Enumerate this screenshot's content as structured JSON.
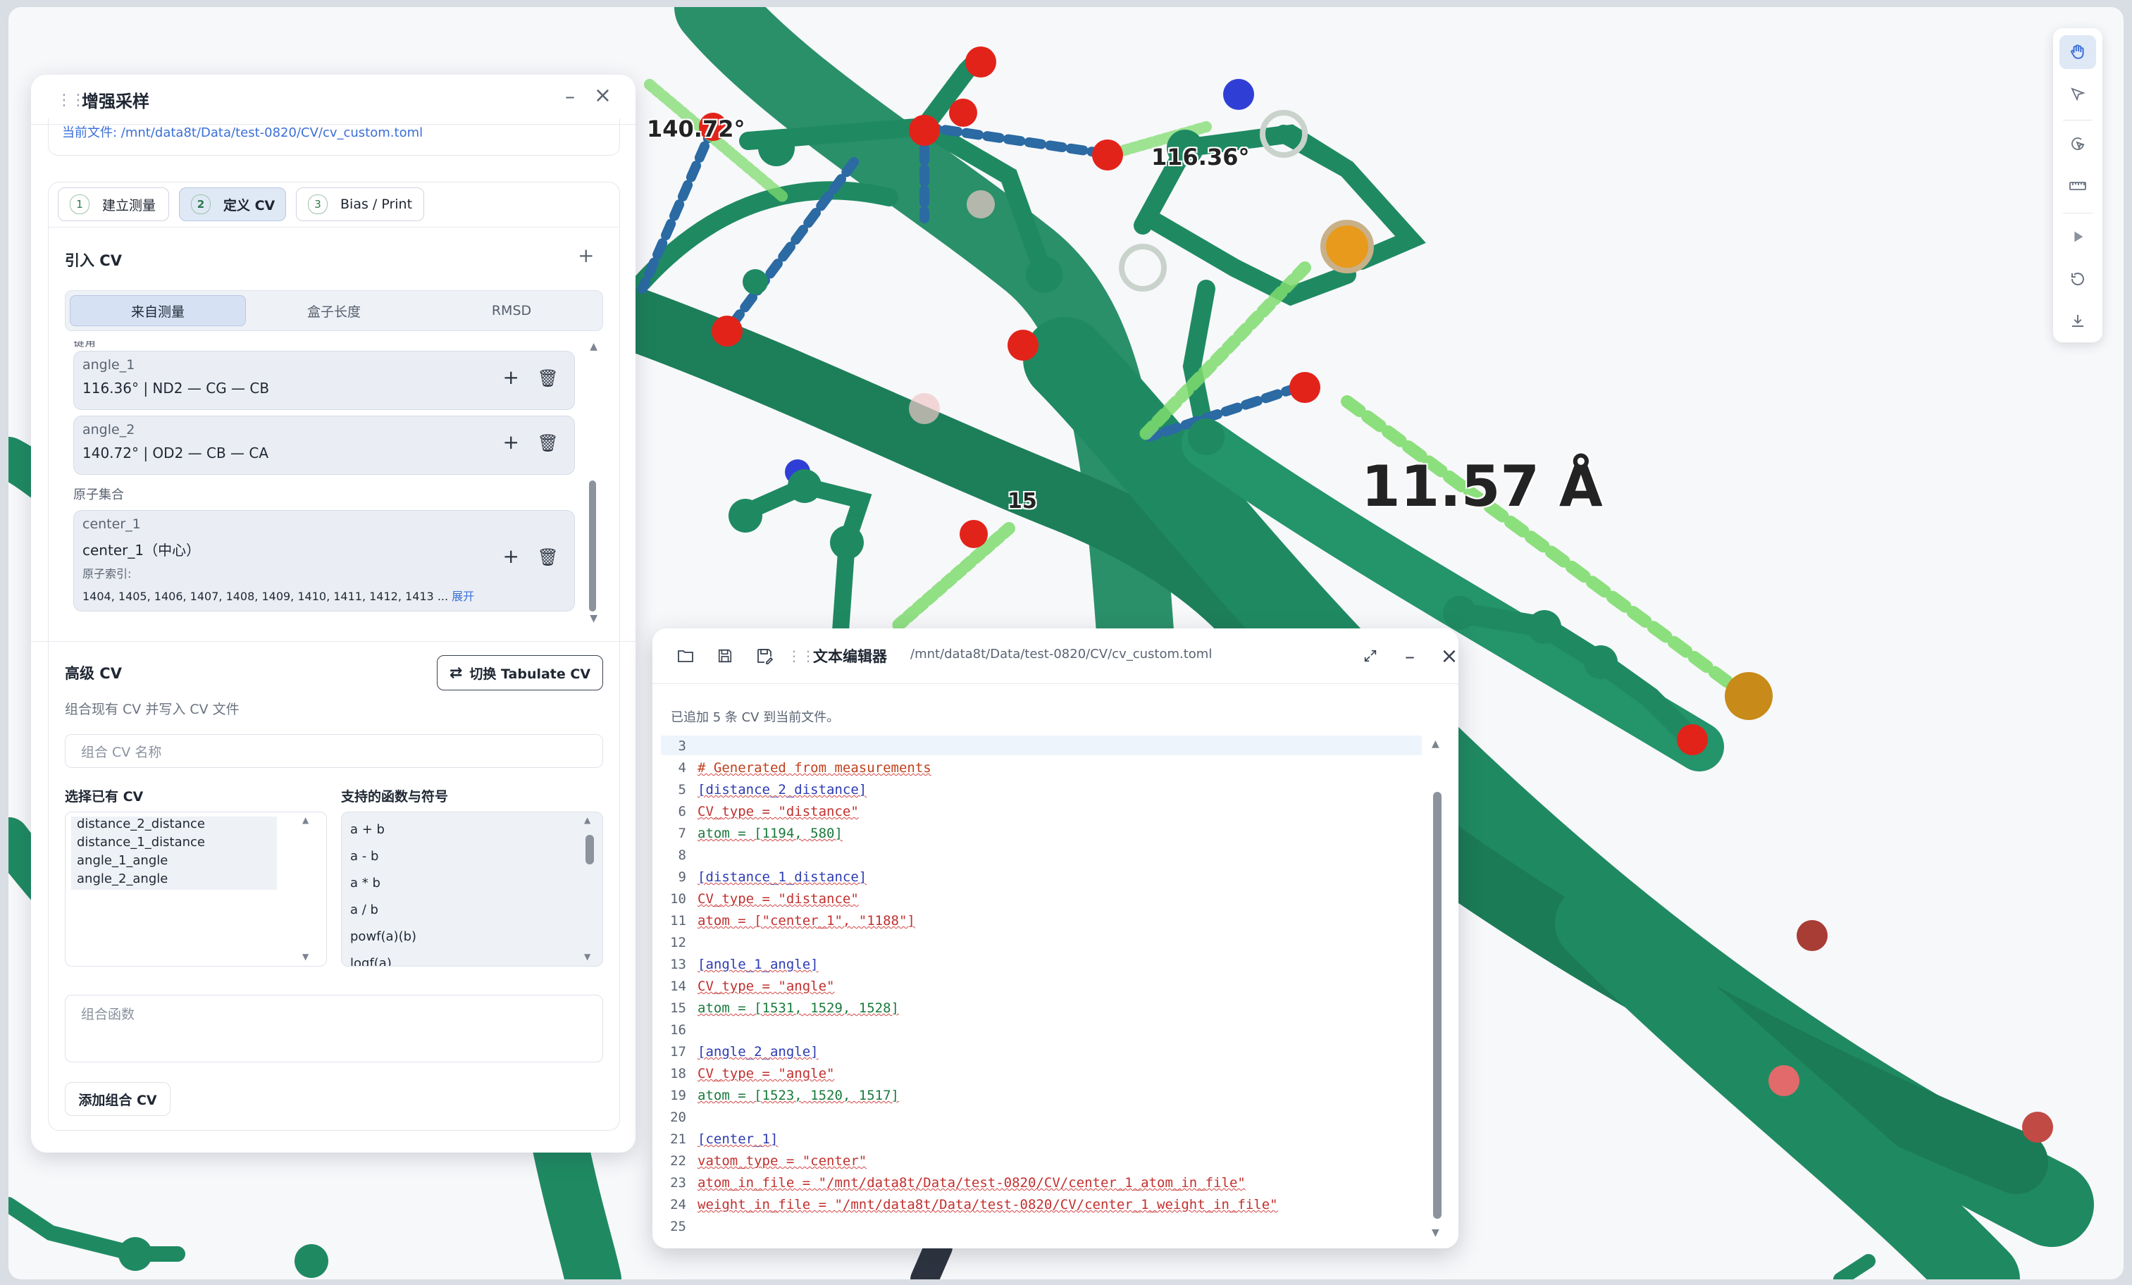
{
  "panel": {
    "title": "增强采样",
    "current_file": "当前文件: /mnt/data8t/Data/test-0820/CV/cv_custom.toml",
    "steps": [
      {
        "num": "1",
        "label": "建立测量"
      },
      {
        "num": "2",
        "label": "定义 CV"
      },
      {
        "num": "3",
        "label": "Bias / Print"
      }
    ],
    "import_cv": {
      "title": "引入 CV",
      "tabs": [
        "来自测量",
        "盒子长度",
        "RMSD"
      ],
      "partial_header": "键角",
      "items": [
        {
          "name": "angle_1",
          "value": "116.36° | ND2 — CG — CB"
        },
        {
          "name": "angle_2",
          "value": "140.72° | OD2 — CB — CA"
        }
      ],
      "group_label": "原子集合",
      "center": {
        "name": "center_1",
        "value": "center_1（中心）",
        "sub_label": "原子索引:",
        "indices": "1404, 1405, 1406, 1407, 1408, 1409, 1410, 1411, 1412, 1413 ...",
        "expand": "展开"
      }
    },
    "advanced": {
      "title": "高级 CV",
      "switch_button": "切换 Tabulate CV",
      "hint": "组合现有 CV 并写入 CV 文件",
      "name_placeholder": "组合 CV 名称",
      "existing_label": "选择已有 CV",
      "existing": [
        "distance_2_distance",
        "distance_1_distance",
        "angle_1_angle",
        "angle_2_angle"
      ],
      "functions_label": "支持的函数与符号",
      "functions": [
        "a + b",
        "a - b",
        "a * b",
        "a / b",
        "powf(a)(b)",
        "logf(a)"
      ],
      "func_placeholder": "组合函数",
      "add_button": "添加组合 CV"
    }
  },
  "viewer": {
    "labels": [
      {
        "text": "140.72°"
      },
      {
        "text": "116.36°"
      },
      {
        "text": "11.57 Å"
      },
      {
        "text": "15"
      }
    ],
    "colors": {
      "protein": "#1f8a62",
      "oxygen": "#e2231a",
      "nitrogen": "#2f3fd6",
      "sulfur": "#e89a1c",
      "hbond": "#2b6aa3",
      "measure": "#7fdc6f"
    }
  },
  "toolbar": {
    "buttons": [
      "hand-icon",
      "pointer-icon",
      "rotate-select-icon",
      "ruler-icon",
      "play-icon",
      "reset-icon",
      "download-icon"
    ]
  },
  "editor": {
    "title": "文本编辑器",
    "path": "/mnt/data8t/Data/test-0820/CV/cv_custom.toml",
    "status": "已追加 5 条 CV 到当前文件。",
    "lines": [
      {
        "n": "3",
        "text": ""
      },
      {
        "n": "4",
        "text": "# Generated from measurements"
      },
      {
        "n": "5",
        "text": "[distance_2_distance]"
      },
      {
        "n": "6",
        "text": "CV_type = \"distance\""
      },
      {
        "n": "7",
        "text": "atom = [1194, 580]"
      },
      {
        "n": "8",
        "text": ""
      },
      {
        "n": "9",
        "text": "[distance_1_distance]"
      },
      {
        "n": "10",
        "text": "CV_type = \"distance\""
      },
      {
        "n": "11",
        "text": "atom = [\"center_1\", \"1188\"]"
      },
      {
        "n": "12",
        "text": ""
      },
      {
        "n": "13",
        "text": "[angle_1_angle]"
      },
      {
        "n": "14",
        "text": "CV_type = \"angle\""
      },
      {
        "n": "15",
        "text": "atom = [1531, 1529, 1528]"
      },
      {
        "n": "16",
        "text": ""
      },
      {
        "n": "17",
        "text": "[angle_2_angle]"
      },
      {
        "n": "18",
        "text": "CV_type = \"angle\""
      },
      {
        "n": "19",
        "text": "atom = [1523, 1520, 1517]"
      },
      {
        "n": "20",
        "text": ""
      },
      {
        "n": "21",
        "text": "[center_1]"
      },
      {
        "n": "22",
        "text": "vatom_type = \"center\""
      },
      {
        "n": "23",
        "text": "atom_in_file = \"/mnt/data8t/Data/test-0820/CV/center_1_atom_in_file\""
      },
      {
        "n": "24",
        "text": "weight_in_file = \"/mnt/data8t/Data/test-0820/CV/center_1_weight_in_file\""
      },
      {
        "n": "25",
        "text": ""
      }
    ]
  }
}
